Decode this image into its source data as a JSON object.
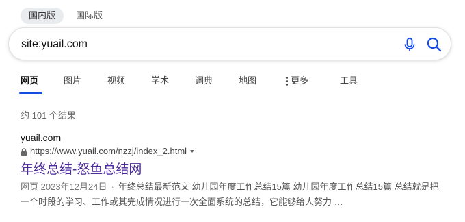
{
  "region_tabs": [
    {
      "label": "国内版",
      "active": true
    },
    {
      "label": "国际版",
      "active": false
    }
  ],
  "search": {
    "query": "site:yuail.com",
    "mic_icon": "microphone-icon",
    "search_icon": "search-icon"
  },
  "scopes": [
    {
      "label": "网页",
      "active": true
    },
    {
      "label": "图片"
    },
    {
      "label": "视频"
    },
    {
      "label": "学术"
    },
    {
      "label": "词典"
    },
    {
      "label": "地图"
    },
    {
      "label": "更多",
      "icon": "more-dots-icon"
    },
    {
      "label": "工具"
    }
  ],
  "results_info": {
    "count_text": "约 101 个结果"
  },
  "results": [
    {
      "site_name": "yuail.com",
      "url": "https://www.yuail.com/nzzj/index_2.html",
      "title": "年终总结-怒鱼总结网",
      "snippet_type": "网页",
      "snippet_date": "2023年12月24日",
      "snippet_separator": "·",
      "snippet_text": "年终总结最新范文 幼儿园年度工作总结15篇 幼儿园年度工作总结15篇 总结就是把一个时段的学习、工作或其完成情况进行一次全面系统的总结，它能够给人努力 …"
    }
  ],
  "colors": {
    "accent": "#174ae4",
    "visited_title": "#4b2a99",
    "tab_active_bg": "#e8ecef"
  }
}
